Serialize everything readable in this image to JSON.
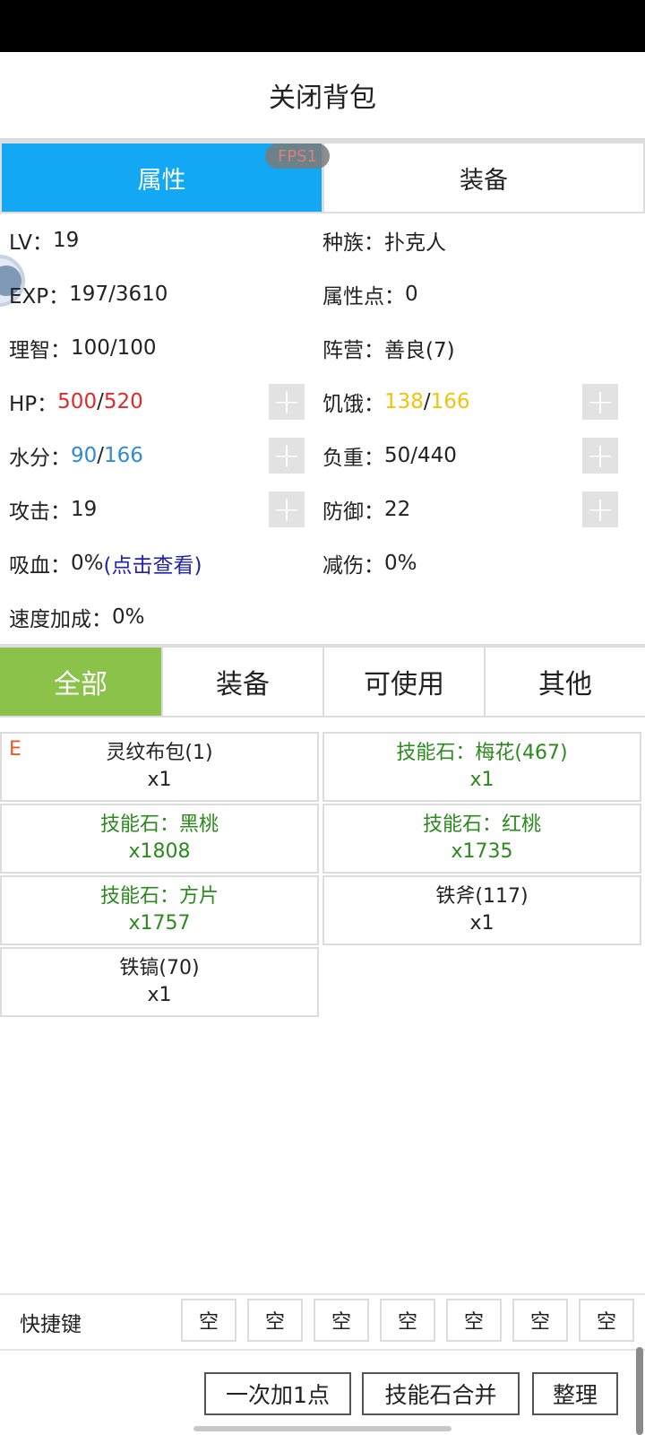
{
  "header": {
    "title": "关闭背包"
  },
  "top_tabs": [
    {
      "label": "属性",
      "active": true
    },
    {
      "label": "装备",
      "active": false
    }
  ],
  "fps_badge": "FPS1",
  "stats": {
    "lv": {
      "label": "LV：",
      "value": "19"
    },
    "race": {
      "label": "种族：",
      "value": "扑克人"
    },
    "exp": {
      "label": "EXP：",
      "value": "197/3610"
    },
    "points": {
      "label": "属性点：",
      "value": "0"
    },
    "sanity": {
      "label": "理智：",
      "value": "100/100"
    },
    "faction": {
      "label": "阵营：",
      "value": "善良(7)"
    },
    "hp": {
      "label": "HP：",
      "current": "500",
      "sep": "/",
      "max": "520"
    },
    "hunger": {
      "label": "饥饿：",
      "current": "138",
      "sep": "/",
      "max": "166"
    },
    "water": {
      "label": "水分：",
      "current": "90",
      "sep": "/",
      "max": "166"
    },
    "weight": {
      "label": "负重：",
      "value": "50/440"
    },
    "attack": {
      "label": "攻击：",
      "value": "19"
    },
    "defense": {
      "label": "防御：",
      "value": "22"
    },
    "lifesteal": {
      "label": "吸血：",
      "value": "0%",
      "link": "(点击查看)"
    },
    "reduction": {
      "label": "减伤：",
      "value": "0%"
    },
    "speed": {
      "label": "速度加成：",
      "value": "0%"
    }
  },
  "plus_icon": "plus-icon",
  "filter_tabs": [
    {
      "label": "全部",
      "active": true
    },
    {
      "label": "装备",
      "active": false
    },
    {
      "label": "可使用",
      "active": false
    },
    {
      "label": "其他",
      "active": false
    }
  ],
  "inventory": [
    {
      "name": "灵纹布包(1)",
      "count": "x1",
      "equipped_mark": "E",
      "color": "#222222"
    },
    {
      "name": "技能石：梅花(467)",
      "count": "x1",
      "color": "#2a8a1c"
    },
    {
      "name": "技能石：黑桃",
      "count": "x1808",
      "color": "#2a8a1c"
    },
    {
      "name": "技能石：红桃",
      "count": "x1735",
      "color": "#2a8a1c"
    },
    {
      "name": "技能石：方片",
      "count": "x1757",
      "color": "#2a8a1c"
    },
    {
      "name": "铁斧(117)",
      "count": "x1",
      "color": "#222222"
    },
    {
      "name": "铁镐(70)",
      "count": "x1",
      "color": "#222222"
    }
  ],
  "hotbar": {
    "label": "快捷键",
    "slots": [
      "空",
      "空",
      "空",
      "空",
      "空",
      "空",
      "空"
    ]
  },
  "actions": {
    "add_one": "一次加1点",
    "merge_stones": "技能石合并",
    "sort": "整理"
  },
  "colors": {
    "tab_active": "#12a8f4",
    "filter_active": "#8bc34a",
    "hp": "#e02a2a",
    "hunger": "#f0c40c",
    "water": "#2f8ad9",
    "skill_stone": "#2a8a1c"
  }
}
